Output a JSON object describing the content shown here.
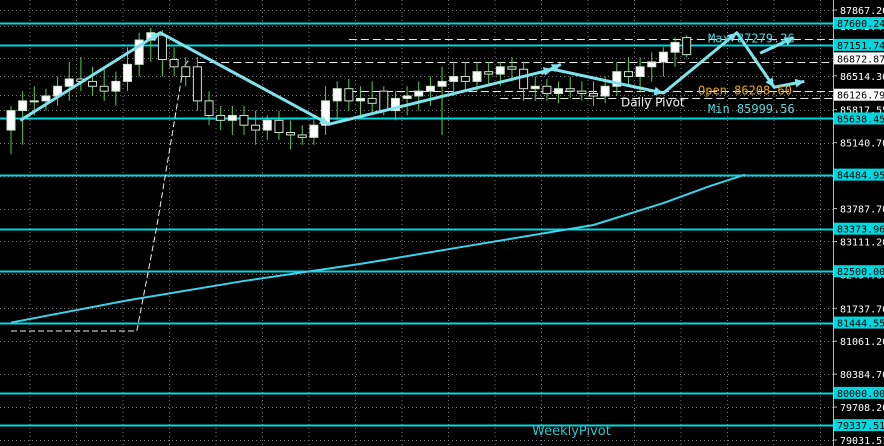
{
  "chart_data": {
    "type": "candlestick",
    "y_range": [
      79031.51,
      87867.2
    ],
    "axis_ticks": [
      "87867.20",
      "87543.44",
      "86872.87",
      "86514.36",
      "86126.79",
      "85817.55",
      "85140.70",
      "84464.30",
      "83787.70",
      "83111.20",
      "82434.60",
      "81737.70",
      "81061.20",
      "80384.70",
      "79708.20",
      "79031.51"
    ],
    "levels": [
      {
        "value": 87600.24,
        "label": "87600.24"
      },
      {
        "value": 87151.74,
        "label": "87151.74"
      },
      {
        "value": 85638.45,
        "label": "85638.45"
      },
      {
        "value": 84484.95,
        "label": "84484.95"
      },
      {
        "value": 83373.96,
        "label": "83373.96"
      },
      {
        "value": 82500.0,
        "label": "82500.00"
      },
      {
        "value": 81444.55,
        "label": "81444.55"
      },
      {
        "value": 80000.0,
        "label": "80000.00"
      },
      {
        "value": 79337.51,
        "label": "79337.51"
      }
    ],
    "current_price": {
      "value": 86872.87,
      "label": "86872.87"
    },
    "price_white": {
      "value": 86126.79,
      "label": "86126.79"
    },
    "candles": [
      [
        85400,
        85900,
        84900,
        85800
      ],
      [
        85800,
        86200,
        85100,
        86000
      ],
      [
        86000,
        86300,
        85700,
        86000
      ],
      [
        86000,
        86250,
        85800,
        86100
      ],
      [
        86100,
        86500,
        85900,
        86300
      ],
      [
        86300,
        86800,
        86000,
        86450
      ],
      [
        86450,
        86900,
        86200,
        86400
      ],
      [
        86400,
        86700,
        86100,
        86300
      ],
      [
        86300,
        86650,
        86000,
        86200
      ],
      [
        86200,
        86600,
        85900,
        86400
      ],
      [
        86400,
        87100,
        86200,
        86750
      ],
      [
        86750,
        87400,
        86500,
        87250
      ],
      [
        87250,
        87500,
        86800,
        87400
      ],
      [
        87350,
        87450,
        86500,
        86850
      ],
      [
        86850,
        87100,
        86500,
        86700
      ],
      [
        86700,
        86900,
        86300,
        86500
      ],
      [
        86700,
        86900,
        85800,
        86000
      ],
      [
        86000,
        86200,
        85500,
        85700
      ],
      [
        85700,
        85900,
        85400,
        85600
      ],
      [
        85600,
        85900,
        85300,
        85700
      ],
      [
        85700,
        85900,
        85300,
        85500
      ],
      [
        85500,
        85800,
        85100,
        85400
      ],
      [
        85400,
        85700,
        85200,
        85600
      ],
      [
        85600,
        85800,
        85200,
        85350
      ],
      [
        85350,
        85600,
        85000,
        85300
      ],
      [
        85300,
        85500,
        85100,
        85250
      ],
      [
        85250,
        85600,
        85100,
        85500
      ],
      [
        85500,
        86300,
        85300,
        86000
      ],
      [
        86000,
        86400,
        85600,
        86250
      ],
      [
        86250,
        86450,
        85800,
        86000
      ],
      [
        86000,
        86300,
        85700,
        86050
      ],
      [
        86050,
        86400,
        85700,
        85950
      ],
      [
        86200,
        86300,
        85700,
        85800
      ],
      [
        85800,
        86200,
        85600,
        86050
      ],
      [
        86050,
        86300,
        85700,
        86100
      ],
      [
        86100,
        86400,
        85800,
        86200
      ],
      [
        86200,
        86500,
        85900,
        86300
      ],
      [
        86300,
        86700,
        85300,
        86400
      ],
      [
        86400,
        86800,
        86100,
        86500
      ],
      [
        86500,
        86800,
        86200,
        86400
      ],
      [
        86400,
        86800,
        86200,
        86600
      ],
      [
        86600,
        86800,
        86300,
        86550
      ],
      [
        86550,
        86800,
        86300,
        86700
      ],
      [
        86700,
        86900,
        86400,
        86650
      ],
      [
        86650,
        86800,
        86000,
        86250
      ],
      [
        86250,
        86500,
        86000,
        86300
      ],
      [
        86300,
        86450,
        86000,
        86150
      ],
      [
        86150,
        86400,
        85950,
        86250
      ],
      [
        86250,
        86500,
        86050,
        86200
      ],
      [
        86200,
        86400,
        86000,
        86150
      ],
      [
        86150,
        86400,
        85900,
        86100
      ],
      [
        86100,
        86500,
        85950,
        86300
      ],
      [
        86300,
        86800,
        86100,
        86600
      ],
      [
        86600,
        86900,
        86300,
        86500
      ],
      [
        86500,
        86900,
        86200,
        86700
      ],
      [
        86700,
        87000,
        86400,
        86800
      ],
      [
        86800,
        87100,
        86500,
        87000
      ],
      [
        87000,
        87300,
        86700,
        87200
      ],
      [
        87300,
        87350,
        86900,
        86950
      ]
    ],
    "moving_average": [
      [
        0,
        81444.55
      ],
      [
        10,
        81900
      ],
      [
        20,
        82300
      ],
      [
        30,
        82650
      ],
      [
        40,
        83050
      ],
      [
        50,
        83450
      ],
      [
        56,
        83900
      ],
      [
        60,
        84250
      ],
      [
        63,
        84483
      ]
    ],
    "dashed_trace": [
      [
        0,
        81270
      ],
      [
        10.8,
        81270
      ],
      [
        12.5,
        83400
      ],
      [
        14.8,
        86700
      ],
      [
        15.3,
        86850
      ]
    ],
    "zigzag": [
      [
        0.8,
        85600
      ],
      [
        12.8,
        87400
      ],
      [
        27.3,
        85520
      ],
      [
        46.5,
        86650
      ],
      [
        56,
        86160
      ],
      [
        62.3,
        87400
      ],
      [
        65.5,
        86280
      ],
      [
        68.1,
        86400
      ]
    ],
    "zigzag_arrows": [
      [
        [
          64.3,
          86980
        ],
        [
          67.2,
          87300
        ]
      ],
      [
        [
          45.5,
          86560
        ],
        [
          47.2,
          86750
        ]
      ]
    ],
    "dashed_levels": [
      {
        "value": 87279.26,
        "x_from": 29,
        "x_to": 80
      },
      {
        "value": 86208.6,
        "x_from": 29,
        "x_to": 80
      },
      {
        "value": 86800.0,
        "x_from": 16,
        "x_to": 80
      },
      {
        "value": 86200.0,
        "x_from": 29,
        "x_to": 80
      },
      {
        "value": 86050.0,
        "x_from": 42,
        "x_to": 80
      }
    ],
    "annotations": {
      "max": {
        "text": "Max 87279.26",
        "value": 87279.26,
        "color": "#57d6dc"
      },
      "open": {
        "text": "Open 86208.60",
        "value": 86208.6,
        "color": "#e6a817"
      },
      "min": {
        "text": "Min 85999.56",
        "value": 85999.56,
        "color": "#57d6dc"
      },
      "daily_pivot": {
        "text": "Daily Pivot",
        "value": 86126.79,
        "color": "#f0f0f0"
      },
      "weekly_pivot": {
        "text": "WeeklyPivot",
        "value": 79337.51,
        "color": "#2ec5cf"
      }
    },
    "colors": {
      "background": "#000000",
      "level_line": "#00d8e0",
      "ma_line": "#39d4ec",
      "zigzag": "#7fe3ee",
      "bull_candle": "#ffffff",
      "bear_candle": "#000000",
      "candle_outline": "#cde3cd",
      "wick": "#55cc55",
      "grid": "#7a7a7a",
      "label_bg": "#00d8e0",
      "label_text": "#000000",
      "axis_text": "#ffffff",
      "current_price_bg": "#ffffff",
      "current_price_text": "#000000"
    }
  }
}
